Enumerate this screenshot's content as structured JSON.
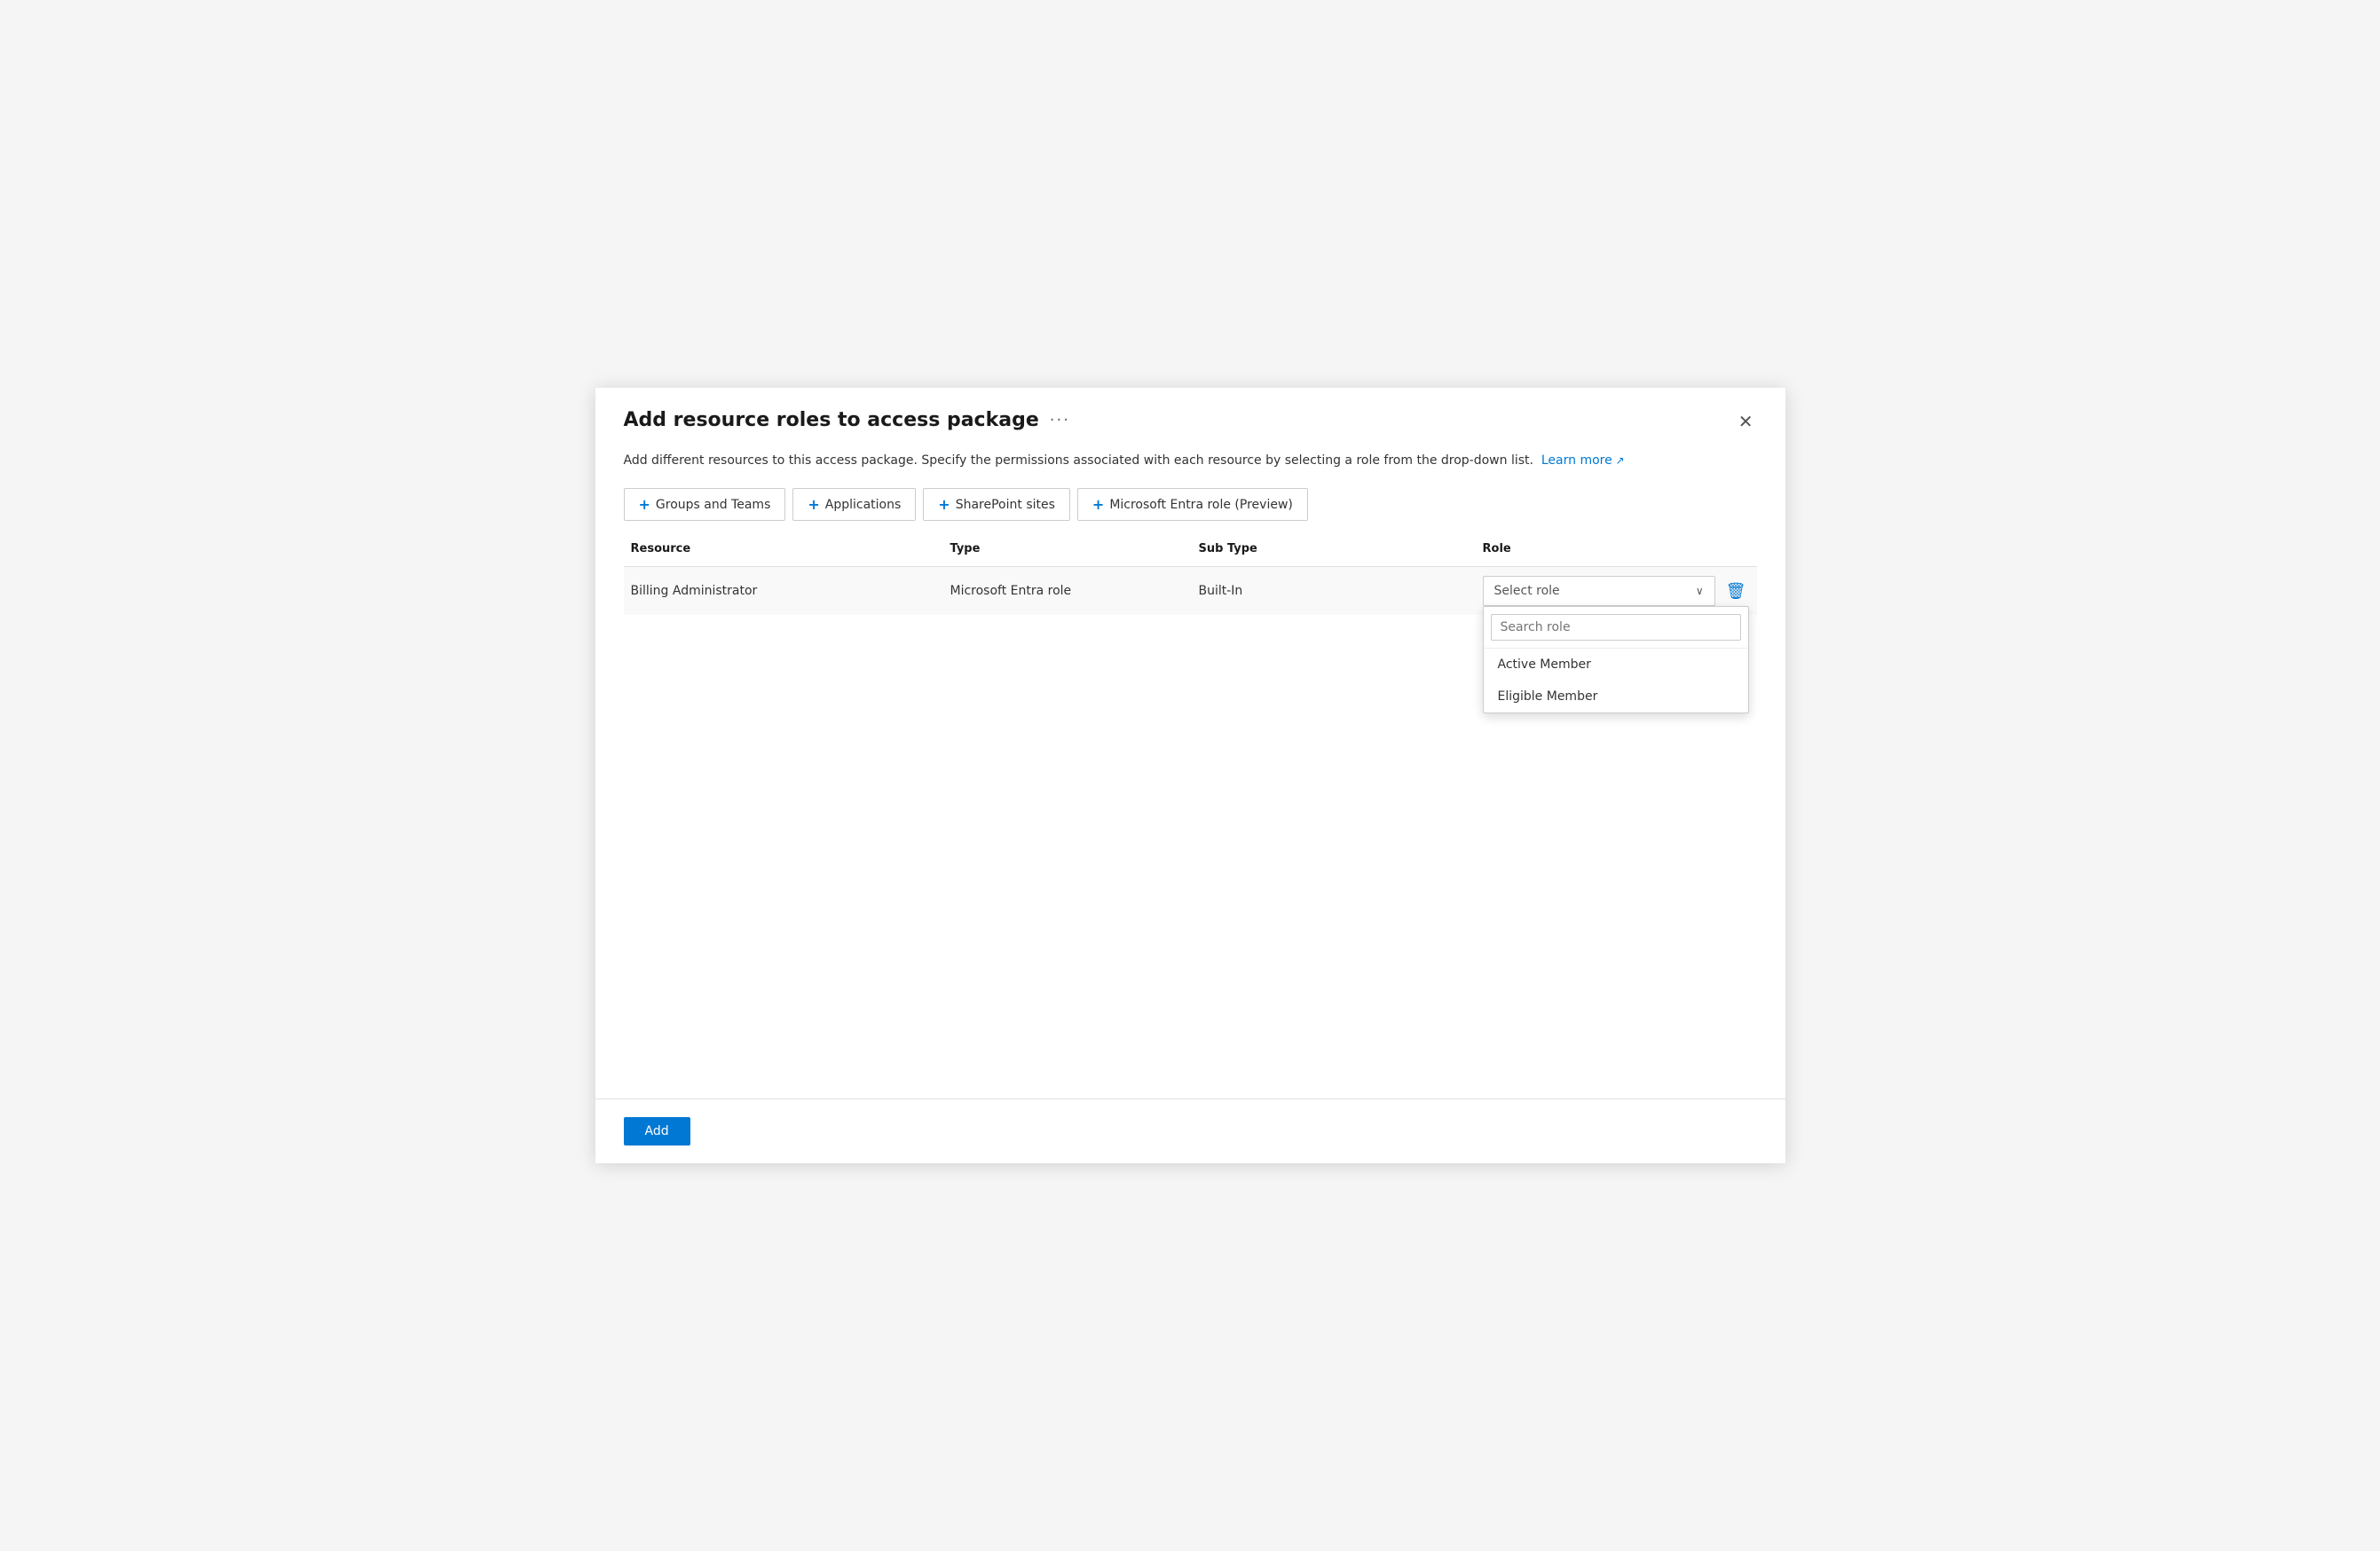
{
  "modal": {
    "title": "Add resource roles to access package",
    "more_label": "···",
    "description": "Add different resources to this access package. Specify the permissions associated with each resource by selecting a role from the drop-down list.",
    "learn_more_label": "Learn more",
    "close_label": "×"
  },
  "toolbar": {
    "groups_teams_label": "Groups and Teams",
    "applications_label": "Applications",
    "sharepoint_label": "SharePoint sites",
    "entra_label": "Microsoft Entra role (Preview)",
    "plus_symbol": "+"
  },
  "table": {
    "headers": {
      "resource": "Resource",
      "type": "Type",
      "sub_type": "Sub Type",
      "role": "Role"
    },
    "rows": [
      {
        "resource": "Billing Administrator",
        "type": "Microsoft Entra role",
        "sub_type": "Built-In",
        "role_placeholder": "Select role"
      }
    ]
  },
  "role_dropdown": {
    "search_placeholder": "Search role",
    "items": [
      {
        "label": "Active Member"
      },
      {
        "label": "Eligible Member"
      }
    ]
  },
  "footer": {
    "add_label": "Add"
  },
  "icons": {
    "close": "✕",
    "chevron_down": "⌄",
    "delete": "🗑",
    "external_link": "↗"
  }
}
